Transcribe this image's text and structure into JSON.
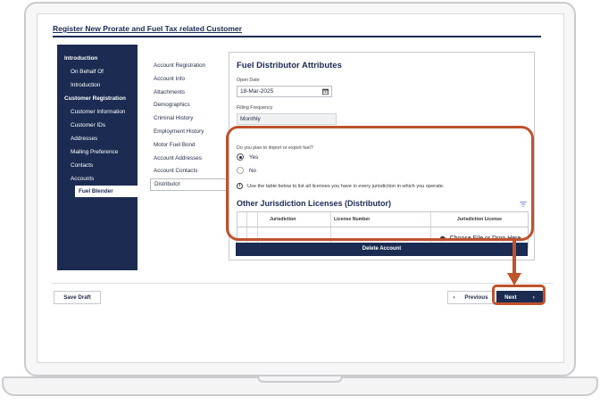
{
  "page_title": "Register New Prorate and Fuel Tax related Customer",
  "left_nav": [
    {
      "label": "Introduction",
      "style": "bold"
    },
    {
      "label": "On Behalf Of",
      "style": "indent"
    },
    {
      "label": "Introduction",
      "style": "indent"
    },
    {
      "label": "Customer Registration",
      "style": "bold"
    },
    {
      "label": "Customer Information",
      "style": "indent"
    },
    {
      "label": "Customer IDs",
      "style": "indent"
    },
    {
      "label": "Addresses",
      "style": "indent"
    },
    {
      "label": "Mailing Preference",
      "style": "indent"
    },
    {
      "label": "Contacts",
      "style": "indent"
    },
    {
      "label": "Accounts",
      "style": "indent"
    },
    {
      "label": "Fuel Blender",
      "style": "sel"
    }
  ],
  "steps": [
    {
      "label": "Account Registration",
      "active": false
    },
    {
      "label": "Account Info",
      "active": false
    },
    {
      "label": "Attachments",
      "active": false
    },
    {
      "label": "Demographics",
      "active": false
    },
    {
      "label": "Criminal History",
      "active": false
    },
    {
      "label": "Employment History",
      "active": false
    },
    {
      "label": "Motor Fuel Bond",
      "active": false
    },
    {
      "label": "Account Addresses",
      "active": false
    },
    {
      "label": "Account Contacts",
      "active": false
    },
    {
      "label": "Distributor",
      "active": true
    }
  ],
  "card": {
    "title": "Fuel Distributor Attributes",
    "open_date_label": "Open Date",
    "open_date_value": "18-Mar-2025",
    "filing_frequency_label": "Filling Frequency",
    "filing_frequency_value": "Monthly",
    "question": "Do you plan to import or export fuel?",
    "yes_label": "Yes",
    "no_label": "No",
    "selected": "Yes",
    "info_text": "Use the table below to list all licenses you have in every jurisdiction in which you operate.",
    "section_title": "Other Jurisdiction Licenses (Distributor)",
    "columns": [
      "Jurisdiction",
      "License Number",
      "Jurisdiction License"
    ],
    "upload_label": "Choose File or Drop Here",
    "delete_label": "Delete Account"
  },
  "footer": {
    "save_label": "Save Draft",
    "previous_label": "Previous",
    "previous_icon": "‹",
    "next_label": "Next",
    "next_icon": "›"
  },
  "colors": {
    "navy": "#1b2b52",
    "highlight": "#c0522c"
  }
}
